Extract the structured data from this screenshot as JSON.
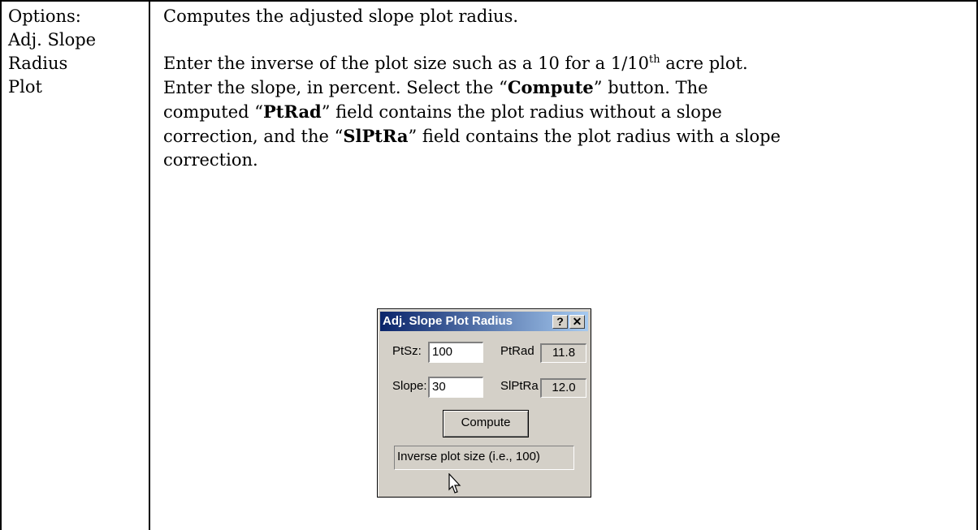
{
  "left_cell": {
    "lines": [
      "Options:",
      "Adj. Slope",
      "Radius",
      "Plot"
    ]
  },
  "content": {
    "summary": "Computes the adjusted slope plot radius.",
    "p1_a": "Enter the inverse of the plot size such as a 10 for a 1/10",
    "p1_sup": "th",
    "p1_b": " acre plot.",
    "p2_a": "Enter the slope, in percent.  Select the “",
    "p2_compute": "Compute",
    "p2_b": "” button.  The",
    "p3_a": "computed “",
    "p3_ptrad": "PtRad",
    "p3_b": "” field contains the plot radius without a slope",
    "p4_a": "correction, and the “",
    "p4_slptra": "SlPtRa",
    "p4_b": "” field contains the plot radius with a slope",
    "p5": "correction."
  },
  "dialog": {
    "title": "Adj. Slope Plot Radius",
    "help_glyph": "?",
    "close_glyph": "✕",
    "ptsz_label": "PtSz:",
    "ptsz_value": "100",
    "slope_label": "Slope:",
    "slope_value": "30",
    "ptrad_label": "PtRad",
    "ptrad_value": "11.8",
    "slptra_label": "SlPtRa",
    "slptra_value": "12.0",
    "compute_label": "Compute",
    "status_text": "Inverse plot size (i.e., 100)"
  },
  "colors": {
    "titlebar_start": "#0a246a",
    "titlebar_end": "#a6caf0",
    "dialog_face": "#d4d0c8"
  }
}
